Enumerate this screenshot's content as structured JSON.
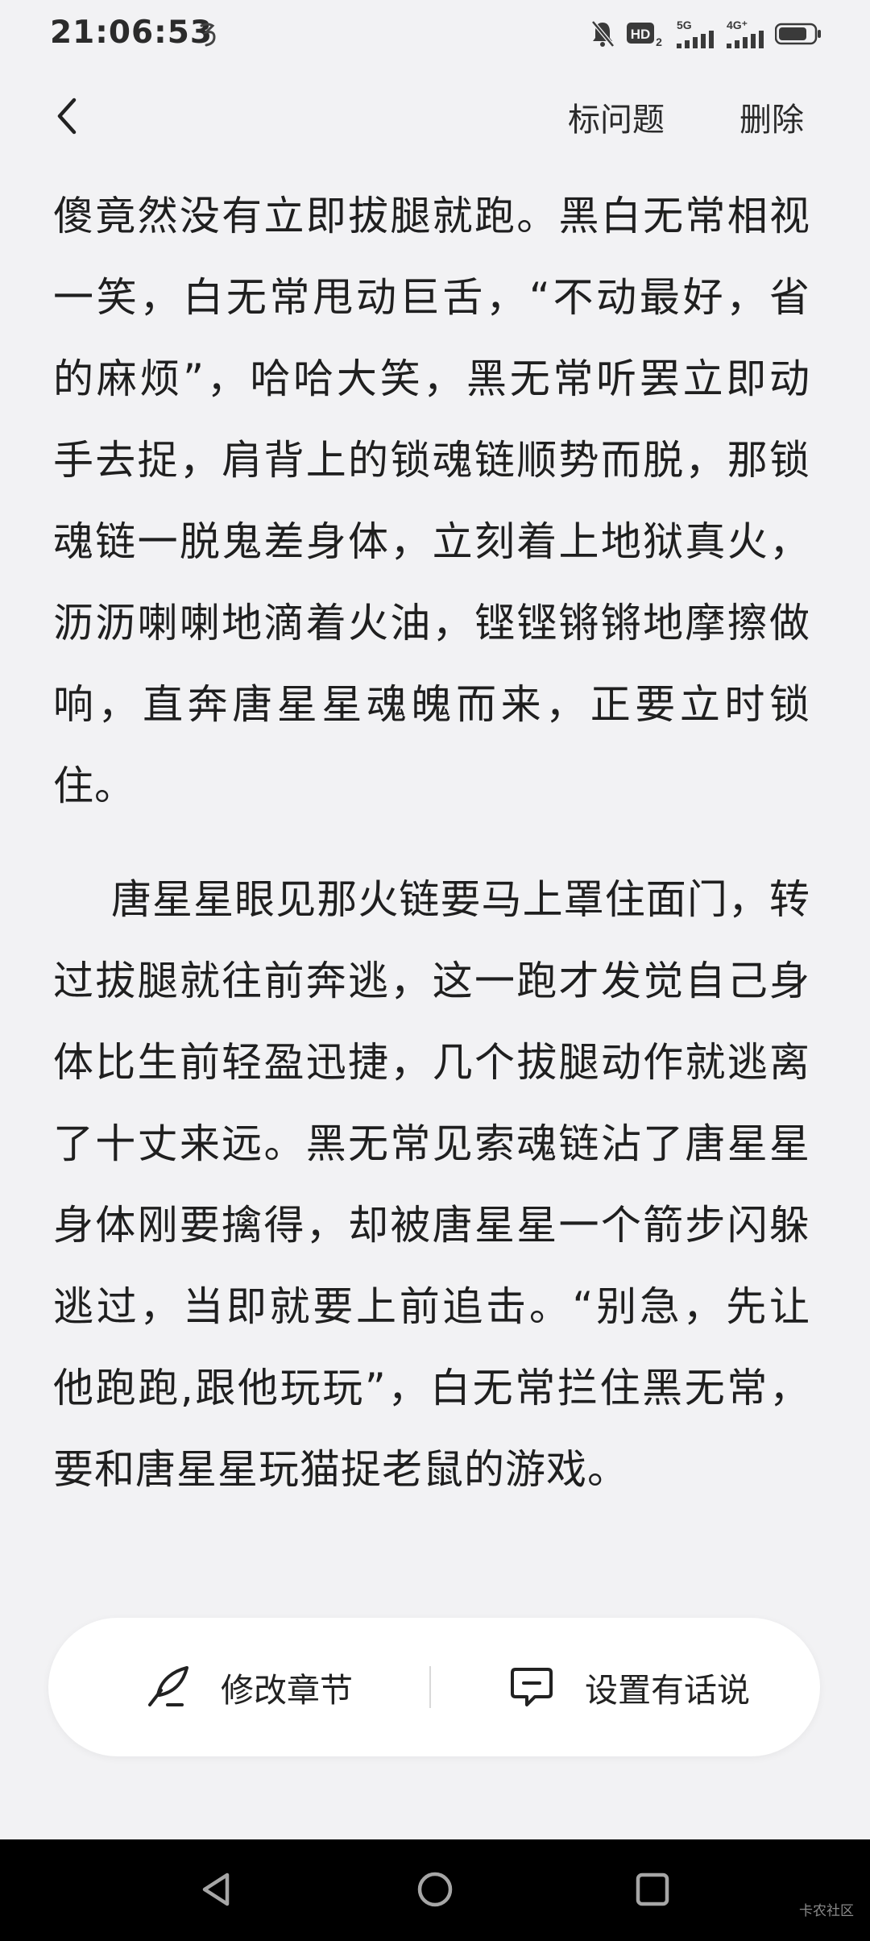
{
  "status_bar": {
    "time": "21:06:53",
    "hd_label": "HD",
    "hd_sub": "2",
    "net1": "5G",
    "net2": "4G⁺"
  },
  "header": {
    "back_icon": "chevron-left-icon",
    "mark_issue": "标问题",
    "delete": "删除"
  },
  "content": {
    "paragraph_1": "傻竟然没有立即拔腿就跑。黑白无常相视一笑，白无常甩动巨舌，“不动最好，省的麻烦”，哈哈大笑，黑无常听罢立即动手去捉，肩背上的锁魂链顺势而脱，那锁魂链一脱鬼差身体，立刻着上地狱真火，沥沥喇喇地滴着火油，铿铿锵锵地摩擦做响，直奔唐星星魂魄而来，正要立时锁住。",
    "paragraph_2": "唐星星眼见那火链要马上罩住面门，转过拔腿就往前奔逃，这一跑才发觉自己身体比生前轻盈迅捷，几个拔腿动作就逃离了十丈来远。黑无常见索魂链沾了唐星星身体刚要擒得，却被唐星星一个箭步闪躲逃过，当即就要上前追击。“别急，先让他跑跑,跟他玩玩”，白无常拦住黑无常，要和唐星星玩猫捉老鼠的游戏。"
  },
  "action_bar": {
    "edit_label": "修改章节",
    "edit_icon": "quill-pen-icon",
    "say_label": "设置有话说",
    "say_icon": "chat-bubble-icon"
  },
  "nav_bar": {
    "watermark": "卡农社区"
  }
}
